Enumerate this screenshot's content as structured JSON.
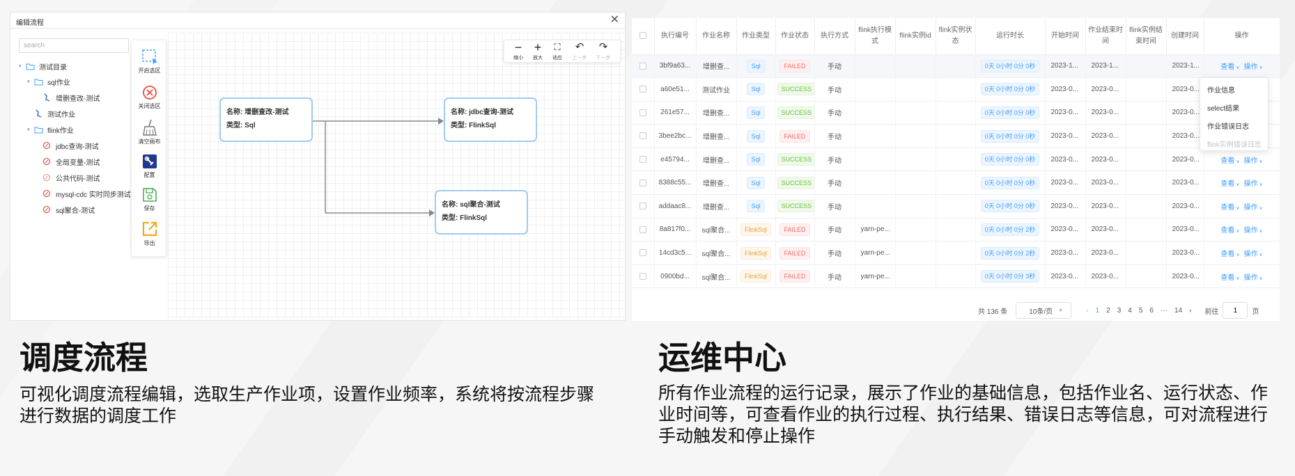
{
  "colors": {
    "accent": "#409eff",
    "node_border": "#9ecbf0",
    "failed": "#f56c6c",
    "success": "#67c23a",
    "flinksql": "#e6a23c"
  },
  "editor": {
    "title": "编辑流程",
    "close": "✕",
    "search_placeholder": "search",
    "tree": [
      {
        "label": "测试目录",
        "icon": "folder-icon",
        "level": 0,
        "expanded": true
      },
      {
        "label": "sql作业",
        "icon": "folder-icon",
        "level": 1,
        "expanded": true
      },
      {
        "label": "增删查改-测试",
        "icon": "sql-job-icon",
        "level": 2
      },
      {
        "label": "测试作业",
        "icon": "sql-job-icon",
        "level": 1
      },
      {
        "label": "flink作业",
        "icon": "folder-icon",
        "level": 1,
        "expanded": true
      },
      {
        "label": "jdbc查询-测试",
        "icon": "flink-job-icon",
        "level": 2
      },
      {
        "label": "全局变量-测试",
        "icon": "flink-job-icon",
        "level": 2
      },
      {
        "label": "公共代码-测试",
        "icon": "flink-job-icon",
        "level": 2
      },
      {
        "label": "mysql-cdc 实时同步测试",
        "icon": "flink-job-icon",
        "level": 2
      },
      {
        "label": "sql聚合-测试",
        "icon": "flink-job-icon",
        "level": 2
      }
    ],
    "tools": [
      {
        "label": "开启选区",
        "icon": "selection-icon"
      },
      {
        "label": "关闭选区",
        "icon": "close-circle-icon"
      },
      {
        "label": "清空画布",
        "icon": "broom-icon"
      },
      {
        "label": "配置",
        "icon": "config-icon"
      },
      {
        "label": "保存",
        "icon": "save-icon"
      },
      {
        "label": "导出",
        "icon": "export-icon"
      }
    ],
    "zoom": [
      {
        "label": "缩小",
        "glyph": "−",
        "icon": "zoom-out-icon"
      },
      {
        "label": "放大",
        "glyph": "+",
        "icon": "zoom-in-icon"
      },
      {
        "label": "适应",
        "glyph": "⛶",
        "icon": "fit-icon"
      },
      {
        "label": "上一步",
        "glyph": "↶",
        "icon": "undo-icon"
      },
      {
        "label": "下一步",
        "glyph": "↷",
        "icon": "redo-icon"
      }
    ],
    "nodes": [
      {
        "name_label": "名称: 增删查改-测试",
        "type_label": "类型: Sql"
      },
      {
        "name_label": "名称: jdbc查询-测试",
        "type_label": "类型: FlinkSql"
      },
      {
        "name_label": "名称: sql聚合-测试",
        "type_label": "类型: FlinkSql"
      }
    ]
  },
  "left_section": {
    "title": "调度流程",
    "desc": "可视化调度流程编辑，选取生产作业项，设置作业频率，系统将按流程步骤进行数据的调度工作"
  },
  "ops": {
    "columns": [
      "执行编号",
      "作业名称",
      "作业类型",
      "作业状态",
      "执行方式",
      "flink执行模式",
      "flink实例id",
      "flink实例状态",
      "运行时长",
      "开始时间",
      "作业结束时间",
      "flink实例结束时间",
      "创建时间",
      "操作"
    ],
    "rows": [
      {
        "id": "3bf9a63...",
        "name": "增删查...",
        "type": "Sql",
        "status": "FAILED",
        "mode": "手动",
        "flink_mode": "",
        "duration": "0天 0小时 0分 0秒",
        "start": "2023-1...",
        "end": "2023-1...",
        "created": "2023-1..."
      },
      {
        "id": "a60e51...",
        "name": "测试作业",
        "type": "Sql",
        "status": "SUCCESS",
        "mode": "手动",
        "flink_mode": "",
        "duration": "0天 0小时 0分 0秒",
        "start": "2023-0...",
        "end": "2023-0...",
        "created": "2023-0..."
      },
      {
        "id": "261e57...",
        "name": "增删查...",
        "type": "Sql",
        "status": "SUCCESS",
        "mode": "手动",
        "flink_mode": "",
        "duration": "0天 0小时 0分 0秒",
        "start": "2023-0...",
        "end": "2023-0...",
        "created": "2023-0..."
      },
      {
        "id": "3bee2bc...",
        "name": "增删查...",
        "type": "Sql",
        "status": "FAILED",
        "mode": "手动",
        "flink_mode": "",
        "duration": "0天 0小时 0分 0秒",
        "start": "2023-0...",
        "end": "2023-0...",
        "created": "2023-0..."
      },
      {
        "id": "e45794...",
        "name": "增删查...",
        "type": "Sql",
        "status": "SUCCESS",
        "mode": "手动",
        "flink_mode": "",
        "duration": "0天 0小时 0分 0秒",
        "start": "2023-0...",
        "end": "2023-0...",
        "created": "2023-0..."
      },
      {
        "id": "8388c55...",
        "name": "增删查...",
        "type": "Sql",
        "status": "SUCCESS",
        "mode": "手动",
        "flink_mode": "",
        "duration": "0天 0小时 0分 0秒",
        "start": "2023-0...",
        "end": "2023-0...",
        "created": "2023-0..."
      },
      {
        "id": "addaac8...",
        "name": "增删查...",
        "type": "Sql",
        "status": "SUCCESS",
        "mode": "手动",
        "flink_mode": "",
        "duration": "0天 0小时 0分 0秒",
        "start": "2023-0...",
        "end": "2023-0...",
        "created": "2023-0..."
      },
      {
        "id": "8a817f0...",
        "name": "sql聚合...",
        "type": "FlinkSql",
        "status": "FAILED",
        "mode": "手动",
        "flink_mode": "yarn-pe...",
        "duration": "0天 0小时 0分 2秒",
        "start": "2023-0...",
        "end": "2023-0...",
        "created": "2023-0..."
      },
      {
        "id": "14cd3c5...",
        "name": "sql聚合...",
        "type": "FlinkSql",
        "status": "FAILED",
        "mode": "手动",
        "flink_mode": "yarn-pe...",
        "duration": "0天 0小时 0分 2秒",
        "start": "2023-0...",
        "end": "2023-0...",
        "created": "2023-0..."
      },
      {
        "id": "0900bd...",
        "name": "sql聚合...",
        "type": "FlinkSql",
        "status": "FAILED",
        "mode": "手动",
        "flink_mode": "yarn-pe...",
        "duration": "0天 0小时 0分 3秒",
        "start": "2023-0...",
        "end": "2023-0...",
        "created": "2023-0..."
      }
    ],
    "view_label": "查看",
    "op_label": "操作",
    "dropdown": [
      "作业信息",
      "select结果",
      "作业错误日志",
      "flink实例错误日志"
    ],
    "pagination": {
      "total": "共 136 条",
      "page_size": "10条/页",
      "pages": [
        "1",
        "2",
        "3",
        "4",
        "5",
        "6",
        "···",
        "14"
      ],
      "current": "1",
      "prev": "‹",
      "next": "›",
      "goto": "前往",
      "goto_value": "1",
      "page_unit": "页"
    }
  },
  "right_section": {
    "title": "运维中心",
    "desc": "所有作业流程的运行记录，展示了作业的基础信息，包括作业名、运行状态、作业时间等，可查看作业的执行过程、执行结果、错误日志等信息，可对流程进行手动触发和停止操作"
  }
}
